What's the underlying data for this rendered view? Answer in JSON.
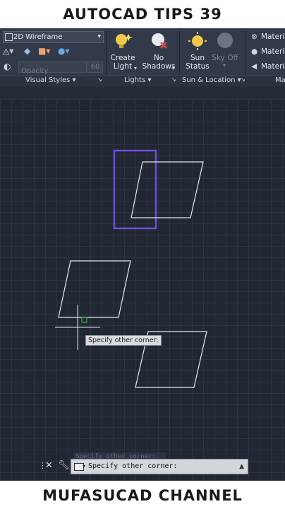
{
  "header": {
    "title": "AUTOCAD TIPS 39"
  },
  "footer": {
    "title": "MUFASUCAD CHANNEL"
  },
  "ribbon": {
    "visual_style": "2D Wireframe",
    "opacity_placeholder": "Opacity",
    "opacity_value": "60",
    "panels": [
      {
        "label": "Visual Styles ▾"
      },
      {
        "label": "Lights ▾"
      },
      {
        "label": "Sun & Location ▾"
      },
      {
        "label": "Ma"
      }
    ],
    "buttons": {
      "create_light": "Create\nLight",
      "no_shadows": "No\nShadows",
      "sun_status": "Sun\nStatus",
      "sky_off": "Sky Off"
    },
    "materials": [
      "Materia",
      "Materia",
      "Materia"
    ]
  },
  "canvas": {
    "tooltip": "Specify other corner:",
    "ghost_text": "Specify other corner:"
  },
  "command_line": {
    "prompt": "Specify other corner:"
  },
  "colors": {
    "background": "#222935",
    "selection_box": "#6a4fd8",
    "shape_stroke": "#e6e9ee"
  }
}
